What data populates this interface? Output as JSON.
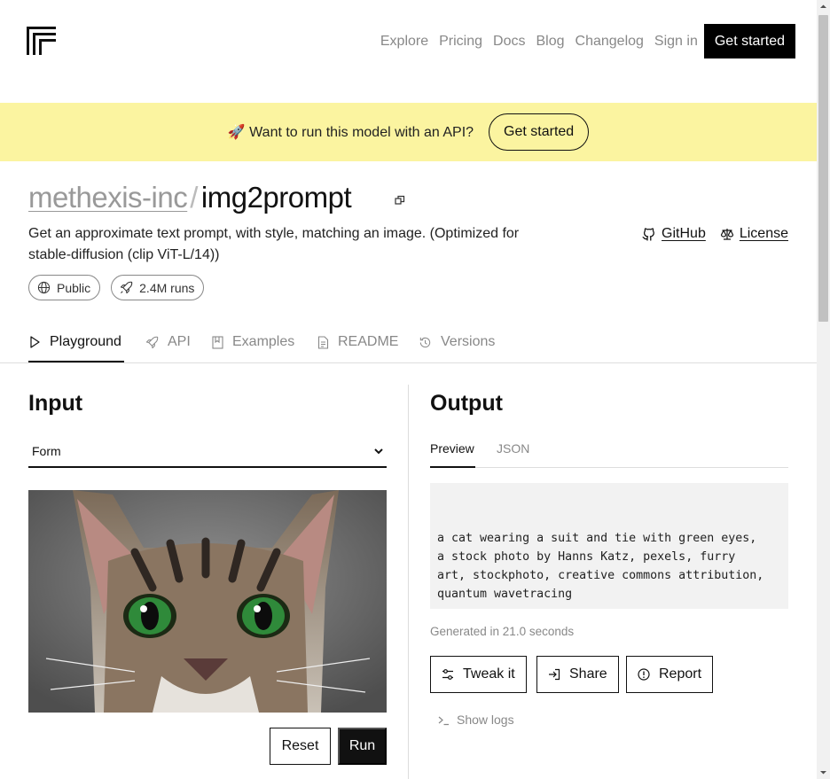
{
  "nav": {
    "items": [
      "Explore",
      "Pricing",
      "Docs",
      "Blog",
      "Changelog",
      "Sign in"
    ],
    "cta": "Get started"
  },
  "banner": {
    "text": "🚀 Want to run this model with an API?",
    "button": "Get started",
    "bg_color": "#fbf4a0"
  },
  "model": {
    "owner": "methexis-inc",
    "separator": "/",
    "name": "img2prompt",
    "description": "Get an approximate text prompt, with style, matching an image. (Optimized for stable-diffusion (clip ViT-L/14))",
    "links": [
      "GitHub",
      "License"
    ],
    "visibility": "Public",
    "runs": "2.4M runs"
  },
  "tabs": [
    "Playground",
    "API",
    "Examples",
    "README",
    "Versions"
  ],
  "input": {
    "title": "Input",
    "select_value": "Form",
    "reset": "Reset",
    "run": "Run"
  },
  "output": {
    "title": "Output",
    "tabs": [
      "Preview",
      "JSON"
    ],
    "text": "a cat wearing a suit and tie with green eyes,\na stock photo by Hanns Katz, pexels, furry\nart, stockphoto, creative commons attribution,\nquantum wavetracing",
    "generated": "Generated in 21.0 seconds",
    "actions": [
      "Tweak it",
      "Share",
      "Report"
    ],
    "logs": "Show logs"
  },
  "icons": [
    "replicate-logo-icon",
    "copy-icon",
    "github-icon",
    "scale-icon",
    "globe-icon",
    "rocket-icon",
    "play-icon",
    "book-icon",
    "file-icon",
    "history-icon",
    "chevron-down-icon",
    "sliders-icon",
    "share-icon",
    "alert-icon",
    "terminal-icon"
  ]
}
